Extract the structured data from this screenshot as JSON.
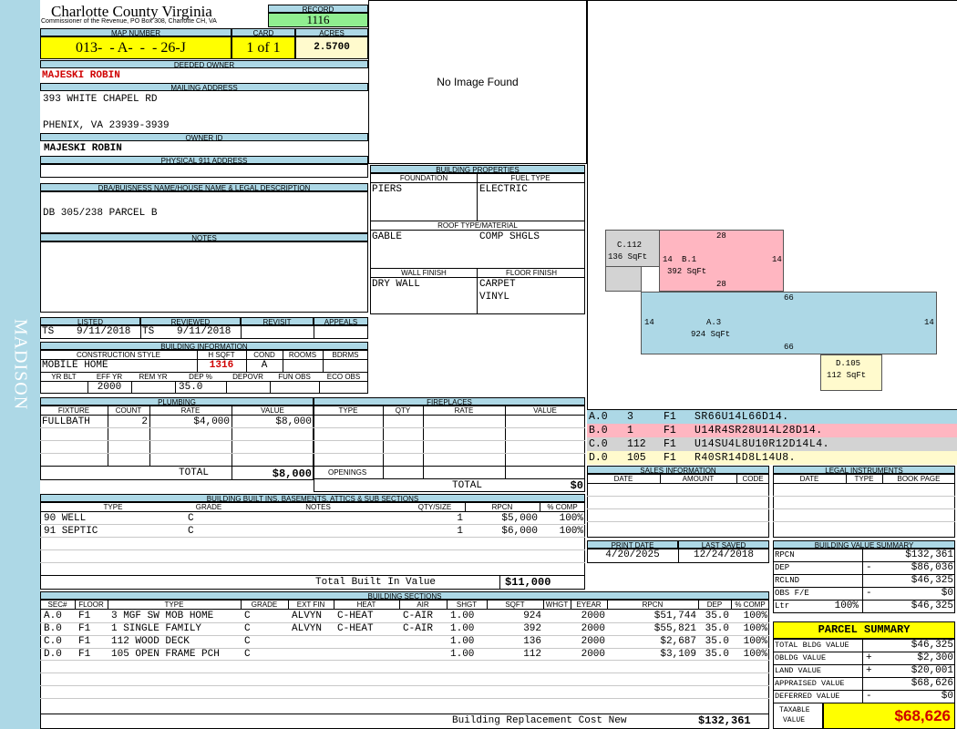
{
  "sidebar": {
    "district": "MADISON"
  },
  "header": {
    "county": "Charlotte County Virginia",
    "commissioner": "Commissioner of the Revenue, PO Box 308, Charlotte CH, VA",
    "record_label": "RECORD",
    "record": "1116",
    "map_label": "MAP NUMBER",
    "map_number": "013-  - A-  -  - 26-J",
    "card_label": "CARD",
    "card": "1 of 1",
    "acres_label": "ACRES",
    "acres": "2.5700"
  },
  "owner": {
    "deeded_label": "DEEDED OWNER",
    "name": "MAJESKI ROBIN",
    "mailing_label": "MAILING ADDRESS",
    "address1": "393 WHITE CHAPEL RD",
    "address2": "PHENIX, VA 23939-3939",
    "owner_id_label": "OWNER ID",
    "owner_id": "MAJESKI ROBIN",
    "physical_label": "PHYSICAL 911 ADDRESS",
    "dba_label": "DBA/BUISNESS NAME/HOUSE NAME & LEGAL DESCRIPTION",
    "legal": "DB 305/238 PARCEL B",
    "notes_label": "NOTES"
  },
  "photo": {
    "text": "No Image Found"
  },
  "building_props": {
    "title": "BUILDING PROPERTIES",
    "foundation_label": "FOUNDATION",
    "fuel_label": "FUEL TYPE",
    "foundation": "PIERS",
    "fuel": "ELECTRIC",
    "roof_label": "ROOF TYPE/MATERIAL",
    "roof_type": "GABLE",
    "roof_material": "COMP SHGLS",
    "wall_label": "WALL FINISH",
    "floor_label": "FLOOR FINISH",
    "wall": "DRY WALL",
    "floor1": "CARPET",
    "floor2": "VINYL"
  },
  "listing": {
    "listed_label": "LISTED",
    "reviewed_label": "REVIEWED",
    "revisit_label": "REVISIT",
    "appeals_label": "APPEALS",
    "listed_by": "TS",
    "listed_date": "9/11/2018",
    "reviewed_by": "TS",
    "reviewed_date": "9/11/2018"
  },
  "building_info": {
    "title": "BUILDING INFORMATION",
    "cs_label": "CONSTRUCTION STYLE",
    "hsqft_label": "H SQFT",
    "cond_label": "COND",
    "rooms_label": "ROOMS",
    "bdrms_label": "BDRMS",
    "style": "MOBILE HOME",
    "hsqft": "1316",
    "cond": "A",
    "yrblt_label": "YR BLT",
    "effyr_label": "EFF YR",
    "remyr_label": "REM YR",
    "dep_label": "DEP %",
    "depovr_label": "DEPOVR",
    "funobs_label": "FUN OBS",
    "ecoobs_label": "ECO OBS",
    "eff_yr": "2000",
    "dep": "35.0"
  },
  "plumbing": {
    "title": "PLUMBING",
    "headers": [
      "FIXTURE",
      "COUNT",
      "RATE",
      "VALUE"
    ],
    "rows": [
      {
        "fixture": "FULLBATH",
        "count": "2",
        "rate": "$4,000",
        "value": "$8,000"
      }
    ],
    "total_label": "TOTAL",
    "total": "$8,000"
  },
  "fireplaces": {
    "title": "FIREPLACES",
    "headers": [
      "TYPE",
      "QTY",
      "RATE",
      "VALUE"
    ],
    "openings_label": "OPENINGS",
    "total_label": "TOTAL",
    "total": "$0"
  },
  "builtins": {
    "title": "BUILDING BUILT INS, BASEMENTS, ATTICS & SUB SECTIONS",
    "headers": [
      "TYPE",
      "GRADE",
      "NOTES",
      "QTY/SIZE",
      "RPCN",
      "% COMP"
    ],
    "rows": [
      {
        "type": "90 WELL",
        "grade": "C",
        "qty": "1",
        "rpcn": "$5,000",
        "comp": "100%"
      },
      {
        "type": "91 SEPTIC",
        "grade": "C",
        "qty": "1",
        "rpcn": "$6,000",
        "comp": "100%"
      }
    ],
    "total_label": "Total Built In Value",
    "total": "$11,000"
  },
  "sections": {
    "title": "BUILDING SECTIONS",
    "headers": [
      "SEC#",
      "FLOOR",
      "TYPE",
      "GRADE",
      "EXT FIN",
      "HEAT",
      "AIR",
      "SHGT",
      "SQFT",
      "WHGT",
      "EYEAR",
      "RPCN",
      "DEP",
      "% COMP"
    ],
    "rows": [
      {
        "sec": "A.0",
        "floor": "F1",
        "type": "3 MGF SW MOB HOME",
        "grade": "C",
        "ext": "ALVYN",
        "heat": "C-HEAT",
        "air": "C-AIR",
        "shgt": "1.00",
        "sqft": "924",
        "eyear": "2000",
        "rpcn": "$51,744",
        "dep": "35.0",
        "comp": "100%"
      },
      {
        "sec": "B.0",
        "floor": "F1",
        "type": "1 SINGLE FAMILY",
        "grade": "C",
        "ext": "ALVYN",
        "heat": "C-HEAT",
        "air": "C-AIR",
        "shgt": "1.00",
        "sqft": "392",
        "eyear": "2000",
        "rpcn": "$55,821",
        "dep": "35.0",
        "comp": "100%"
      },
      {
        "sec": "C.0",
        "floor": "F1",
        "type": "112 WOOD DECK",
        "grade": "C",
        "ext": "",
        "heat": "",
        "air": "",
        "shgt": "1.00",
        "sqft": "136",
        "eyear": "2000",
        "rpcn": "$2,687",
        "dep": "35.0",
        "comp": "100%"
      },
      {
        "sec": "D.0",
        "floor": "F1",
        "type": "105 OPEN FRAME PCH",
        "grade": "C",
        "ext": "",
        "heat": "",
        "air": "",
        "shgt": "1.00",
        "sqft": "112",
        "eyear": "2000",
        "rpcn": "$3,109",
        "dep": "35.0",
        "comp": "100%"
      }
    ],
    "total_label": "Building Replacement Cost New",
    "total": "$132,361"
  },
  "sketch": {
    "c_label": "C.112",
    "c_area": "136 SqFt",
    "b_label": "B.1",
    "b_area": "392 SqFt",
    "b_top": "28",
    "b_bottom": "28",
    "b_left": "14",
    "b_right": "14",
    "a_label": "A.3",
    "a_area": "924 SqFt",
    "a_top": "66",
    "a_bottom": "66",
    "a_left": "14",
    "a_right": "14",
    "d_label": "D.105",
    "d_area": "112 SqFt",
    "colors": {
      "a": "#add8e6",
      "b": "#ffb6c1",
      "c": "#d3d3d3",
      "d": "#fffacd"
    }
  },
  "vectors": [
    {
      "sec": "A.0",
      "n": "3",
      "f": "F1",
      "v": "SR66U14L66D14.",
      "color": "#add8e6"
    },
    {
      "sec": "B.0",
      "n": "1",
      "f": "F1",
      "v": "U14R4SR28U14L28D14.",
      "color": "#ffb6c1"
    },
    {
      "sec": "C.0",
      "n": "112",
      "f": "F1",
      "v": "U14SU4L8U10R12D14L4.",
      "color": "#d3d3d3"
    },
    {
      "sec": "D.0",
      "n": "105",
      "f": "F1",
      "v": "R40SR14D8L14U8.",
      "color": "#fffacd"
    }
  ],
  "sales": {
    "title": "SALES INFORMATION",
    "headers": [
      "DATE",
      "AMOUNT",
      "CODE"
    ]
  },
  "legal_inst": {
    "title": "LEGAL INSTRUMENTS",
    "headers": [
      "DATE",
      "TYPE",
      "BOOK PAGE"
    ]
  },
  "dates": {
    "print_label": "PRINT DATE",
    "saved_label": "LAST SAVED",
    "print": "4/20/2025",
    "saved": "12/24/2018"
  },
  "value_summary": {
    "title": "BUILDING VALUE SUMMARY",
    "rows": [
      {
        "label": "RPCN",
        "sign": "",
        "pct": "",
        "value": "$132,361"
      },
      {
        "label": "DEP",
        "sign": "-",
        "pct": "",
        "value": "$86,036"
      },
      {
        "label": "RCLND",
        "sign": "",
        "pct": "",
        "value": "$46,325"
      },
      {
        "label": "OBS F/E",
        "sign": "-",
        "pct": "",
        "value": "$0"
      },
      {
        "label": "Ltr",
        "sign": "",
        "pct": "100%",
        "value": "$46,325"
      }
    ]
  },
  "parcel_summary": {
    "title": "PARCEL SUMMARY",
    "rows": [
      {
        "label": "TOTAL BLDG VALUE",
        "sign": "",
        "value": "$46,325"
      },
      {
        "label": "OBLDG VALUE",
        "sign": "+",
        "value": "$2,300"
      },
      {
        "label": "LAND VALUE",
        "sign": "+",
        "value": "$20,001"
      },
      {
        "label": "APPRAISED VALUE",
        "sign": "",
        "value": "$68,626"
      },
      {
        "label": "DEFERRED VALUE",
        "sign": "-",
        "value": "$0"
      }
    ],
    "taxable_label1": "TAXABLE",
    "taxable_label2": "VALUE",
    "taxable": "$68,626"
  }
}
